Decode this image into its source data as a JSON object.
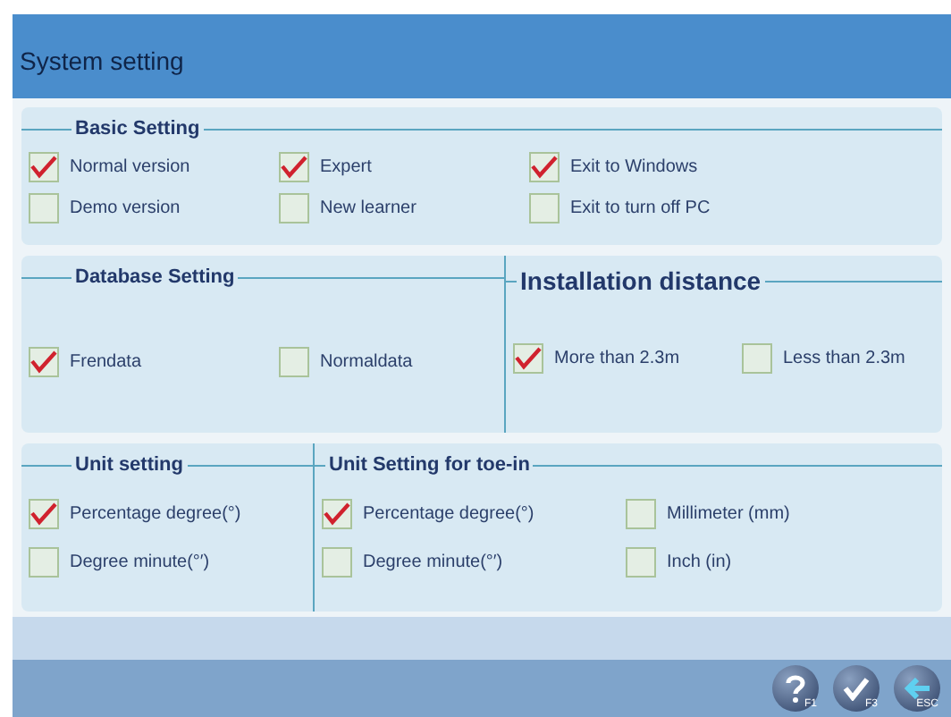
{
  "window": {
    "title": "System setting"
  },
  "panels": [
    {
      "sections": [
        {
          "title": "Basic Setting",
          "items": [
            {
              "label": "Normal version",
              "checked": true
            },
            {
              "label": "Expert",
              "checked": true
            },
            {
              "label": "Exit to Windows",
              "checked": true
            },
            {
              "label": "Demo version",
              "checked": false
            },
            {
              "label": "New learner",
              "checked": false
            },
            {
              "label": "Exit to turn off PC",
              "checked": false
            }
          ]
        }
      ]
    },
    {
      "sections": [
        {
          "title": "Database Setting",
          "items": [
            {
              "label": "Frendata",
              "checked": true
            },
            {
              "label": "Normaldata",
              "checked": false
            }
          ]
        },
        {
          "title": "Installation distance",
          "items": [
            {
              "label": "More than 2.3m",
              "checked": true
            },
            {
              "label": "Less than 2.3m",
              "checked": false
            }
          ]
        }
      ]
    },
    {
      "sections": [
        {
          "title": "Unit setting",
          "items": [
            {
              "label": "Percentage degree(°)",
              "checked": true
            },
            {
              "label": "Degree minute(°′)",
              "checked": false
            }
          ]
        },
        {
          "title": "Unit Setting for toe-in",
          "items": [
            {
              "label": "Percentage degree(°)",
              "checked": true
            },
            {
              "label": "Millimeter (mm)",
              "checked": false
            },
            {
              "label": "Degree minute(°′)",
              "checked": false
            },
            {
              "label": "Inch (in)",
              "checked": false
            }
          ]
        }
      ]
    }
  ],
  "buttons": [
    {
      "kind": "help",
      "key": "F1"
    },
    {
      "kind": "confirm",
      "key": "F3"
    },
    {
      "kind": "exit",
      "key": "ESC"
    }
  ]
}
